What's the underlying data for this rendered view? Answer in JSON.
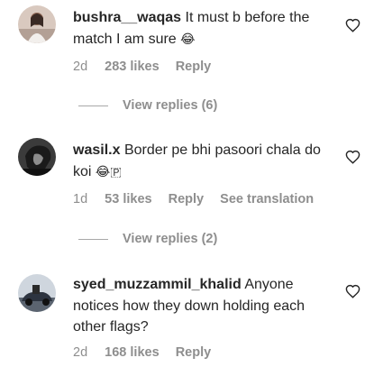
{
  "comments": [
    {
      "username": "bushra__waqas",
      "text": "It must b before the match I am sure",
      "emoji": "😂",
      "time": "2d",
      "likes": "283 likes",
      "reply": "Reply",
      "view_replies": "View replies (6)"
    },
    {
      "username": "wasil.x",
      "text": "Border pe bhi pasoori chala do koi",
      "emoji": "😂🇵",
      "time": "1d",
      "likes": "53 likes",
      "reply": "Reply",
      "see_translation": "See translation",
      "view_replies": "View replies (2)"
    },
    {
      "username": "syed_muzzammil_khalid",
      "text": "Anyone notices how they down holding each other flags?",
      "time": "2d",
      "likes": "168 likes",
      "reply": "Reply"
    }
  ],
  "icons": {
    "like": "heart-outline-icon"
  }
}
